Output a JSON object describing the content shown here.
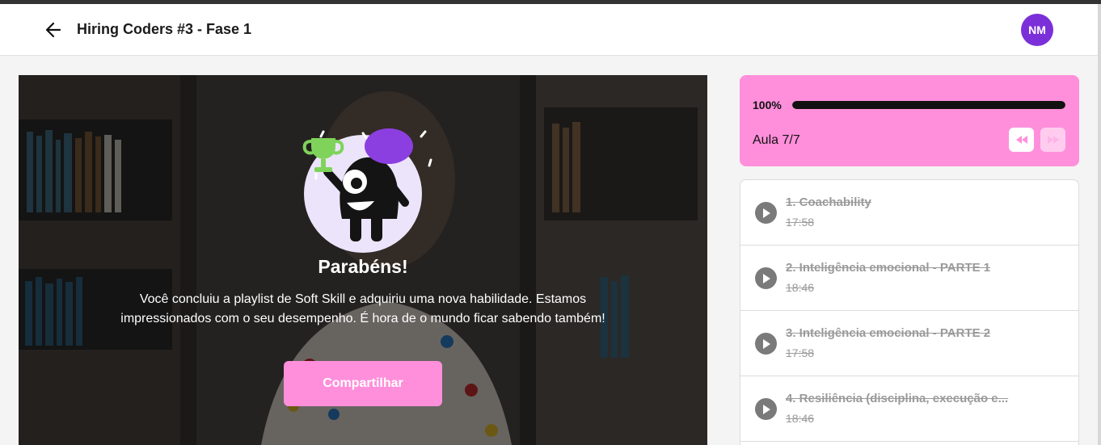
{
  "header": {
    "title": "Hiring Coders #3 - Fase 1",
    "avatar_initials": "NM",
    "avatar_color": "#7b2fd9"
  },
  "modal": {
    "heading": "Parabéns!",
    "message": "Você concluiu a playlist de Soft Skill e adquiriu uma nova habilidade. Estamos impressionados com o seu desempenho. É hora de o mundo ficar sabendo também!",
    "share_label": "Compartilhar"
  },
  "progress": {
    "percent_label": "100%",
    "fraction": 1.0,
    "lesson_label": "Aula 7/7",
    "accent_color": "#ff8fdb"
  },
  "lessons": [
    {
      "title": "1. Coachability",
      "duration": "17:58"
    },
    {
      "title": "2. Inteligência emocional - PARTE 1",
      "duration": "18:46"
    },
    {
      "title": "3. Inteligência emocional - PARTE 2",
      "duration": "17:58"
    },
    {
      "title": "4. Resiliência (disciplina, execução e...",
      "duration": "18:46"
    }
  ],
  "icons": {
    "back": "arrow-left-icon",
    "prev": "rewind-icon",
    "next": "fast-forward-icon",
    "play": "play-icon"
  }
}
